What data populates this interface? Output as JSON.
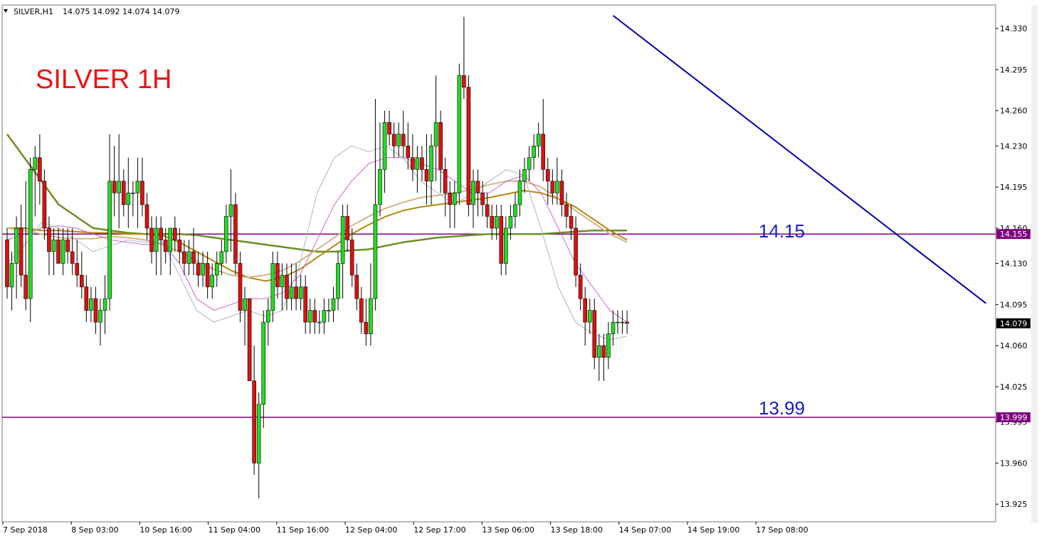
{
  "header": {
    "symbol": "SILVER,H1",
    "ohlc": "14.075 14.092 14.074 14.079"
  },
  "chart_data": {
    "type": "candlestick",
    "title": "SILVER 1H",
    "ylim": [
      13.91,
      14.35
    ],
    "x_ticks": [
      "7 Sep 2018",
      "8 Sep 03:00",
      "10 Sep 16:00",
      "11 Sep 04:00",
      "11 Sep 16:00",
      "12 Sep 04:00",
      "12 Sep 17:00",
      "13 Sep 06:00",
      "13 Sep 18:00",
      "14 Sep 07:00",
      "14 Sep 19:00",
      "17 Sep 08:00"
    ],
    "y_ticks": [
      "14.330",
      "14.295",
      "14.260",
      "14.230",
      "14.195",
      "14.160",
      "14.130",
      "14.095",
      "14.060",
      "14.025",
      "13.995",
      "13.960",
      "13.925"
    ],
    "y_tick_values": [
      14.33,
      14.295,
      14.26,
      14.23,
      14.195,
      14.16,
      14.13,
      14.095,
      14.06,
      14.025,
      13.995,
      13.96,
      13.925
    ],
    "levels": [
      {
        "label": "14.15",
        "badge": "14.155",
        "value": 14.155,
        "color": "#800080"
      },
      {
        "label": "13.99",
        "badge": "13.999",
        "value": 13.999,
        "color": "#800080"
      }
    ],
    "current_price": {
      "label": "14.079",
      "value": 14.079
    },
    "trendline": {
      "color": "#0000aa",
      "start": {
        "bar": 130,
        "price": 14.341
      },
      "end": {
        "bar": 210,
        "price": 14.096
      }
    },
    "candles": [
      [
        14.15,
        14.16,
        14.1,
        14.11
      ],
      [
        14.11,
        14.14,
        14.09,
        14.13
      ],
      [
        14.13,
        14.17,
        14.1,
        14.16
      ],
      [
        14.16,
        14.18,
        14.11,
        14.12
      ],
      [
        14.12,
        14.2,
        14.09,
        14.1
      ],
      [
        14.1,
        14.22,
        14.08,
        14.21
      ],
      [
        14.21,
        14.23,
        14.17,
        14.22
      ],
      [
        14.22,
        14.24,
        14.18,
        14.2
      ],
      [
        14.2,
        14.21,
        14.15,
        14.16
      ],
      [
        14.16,
        14.17,
        14.12,
        14.14
      ],
      [
        14.14,
        14.16,
        14.12,
        14.15
      ],
      [
        14.15,
        14.16,
        14.13,
        14.13
      ],
      [
        14.13,
        14.16,
        14.12,
        14.15
      ],
      [
        14.15,
        14.16,
        14.13,
        14.14
      ],
      [
        14.14,
        14.16,
        14.12,
        14.13
      ],
      [
        14.13,
        14.15,
        14.11,
        14.12
      ],
      [
        14.12,
        14.14,
        14.1,
        14.11
      ],
      [
        14.11,
        14.12,
        14.08,
        14.09
      ],
      [
        14.09,
        14.11,
        14.08,
        14.1
      ],
      [
        14.1,
        14.11,
        14.07,
        14.08
      ],
      [
        14.08,
        14.1,
        14.06,
        14.09
      ],
      [
        14.09,
        14.12,
        14.07,
        14.1
      ],
      [
        14.1,
        14.24,
        14.09,
        14.2
      ],
      [
        14.2,
        14.23,
        14.17,
        14.19
      ],
      [
        14.19,
        14.24,
        14.16,
        14.2
      ],
      [
        14.2,
        14.21,
        14.17,
        14.18
      ],
      [
        14.18,
        14.22,
        14.16,
        14.19
      ],
      [
        14.19,
        14.2,
        14.17,
        14.19
      ],
      [
        14.19,
        14.22,
        14.16,
        14.2
      ],
      [
        14.2,
        14.22,
        14.17,
        14.18
      ],
      [
        14.18,
        14.19,
        14.15,
        14.16
      ],
      [
        14.16,
        14.17,
        14.13,
        14.14
      ],
      [
        14.14,
        14.17,
        14.12,
        14.16
      ],
      [
        14.16,
        14.17,
        14.12,
        14.15
      ],
      [
        14.15,
        14.16,
        14.13,
        14.14
      ],
      [
        14.14,
        14.16,
        14.12,
        14.16
      ],
      [
        14.16,
        14.17,
        14.14,
        14.15
      ],
      [
        14.15,
        14.16,
        14.13,
        14.14
      ],
      [
        14.14,
        14.15,
        14.12,
        14.13
      ],
      [
        14.13,
        14.15,
        14.12,
        14.14
      ],
      [
        14.14,
        14.16,
        14.12,
        14.13
      ],
      [
        14.13,
        14.14,
        14.11,
        14.12
      ],
      [
        14.12,
        14.14,
        14.11,
        14.13
      ],
      [
        14.13,
        14.14,
        14.1,
        14.11
      ],
      [
        14.11,
        14.13,
        14.1,
        14.12
      ],
      [
        14.12,
        14.14,
        14.11,
        14.13
      ],
      [
        14.13,
        14.15,
        14.12,
        14.14
      ],
      [
        14.14,
        14.18,
        14.13,
        14.17
      ],
      [
        14.17,
        14.21,
        14.14,
        14.18
      ],
      [
        14.18,
        14.19,
        14.12,
        14.13
      ],
      [
        14.13,
        14.14,
        14.08,
        14.09
      ],
      [
        14.09,
        14.11,
        14.06,
        14.1
      ],
      [
        14.1,
        14.1,
        14.03,
        14.03
      ],
      [
        14.03,
        14.06,
        13.95,
        13.96
      ],
      [
        13.96,
        14.02,
        13.93,
        14.01
      ],
      [
        14.01,
        14.09,
        13.99,
        14.08
      ],
      [
        14.08,
        14.1,
        14.06,
        14.09
      ],
      [
        14.09,
        14.14,
        14.08,
        14.13
      ],
      [
        14.13,
        14.14,
        14.1,
        14.11
      ],
      [
        14.11,
        14.13,
        14.09,
        14.12
      ],
      [
        14.12,
        14.13,
        14.09,
        14.1
      ],
      [
        14.1,
        14.13,
        14.09,
        14.11
      ],
      [
        14.11,
        14.13,
        14.09,
        14.1
      ],
      [
        14.1,
        14.12,
        14.09,
        14.11
      ],
      [
        14.11,
        14.12,
        14.07,
        14.08
      ],
      [
        14.08,
        14.1,
        14.07,
        14.09
      ],
      [
        14.09,
        14.1,
        14.07,
        14.08
      ],
      [
        14.08,
        14.09,
        14.07,
        14.08
      ],
      [
        14.08,
        14.1,
        14.07,
        14.09
      ],
      [
        14.09,
        14.1,
        14.08,
        14.09
      ],
      [
        14.09,
        14.11,
        14.08,
        14.1
      ],
      [
        14.1,
        14.14,
        14.09,
        14.13
      ],
      [
        14.13,
        14.18,
        14.1,
        14.17
      ],
      [
        14.17,
        14.18,
        14.14,
        14.15
      ],
      [
        14.15,
        14.16,
        14.11,
        14.12
      ],
      [
        14.12,
        14.13,
        14.09,
        14.1
      ],
      [
        14.1,
        14.11,
        14.07,
        14.08
      ],
      [
        14.08,
        14.1,
        14.06,
        14.07
      ],
      [
        14.07,
        14.13,
        14.06,
        14.1
      ],
      [
        14.1,
        14.27,
        14.09,
        14.18
      ],
      [
        14.18,
        14.25,
        14.17,
        14.21
      ],
      [
        14.21,
        14.26,
        14.19,
        14.25
      ],
      [
        14.25,
        14.26,
        14.23,
        14.24
      ],
      [
        14.24,
        14.25,
        14.22,
        14.23
      ],
      [
        14.23,
        14.25,
        14.22,
        14.24
      ],
      [
        14.24,
        14.26,
        14.22,
        14.23
      ],
      [
        14.23,
        14.25,
        14.21,
        14.22
      ],
      [
        14.22,
        14.24,
        14.2,
        14.21
      ],
      [
        14.21,
        14.23,
        14.19,
        14.22
      ],
      [
        14.22,
        14.23,
        14.2,
        14.21
      ],
      [
        14.21,
        14.24,
        14.18,
        14.2
      ],
      [
        14.2,
        14.24,
        14.18,
        14.23
      ],
      [
        14.23,
        14.29,
        14.2,
        14.25
      ],
      [
        14.25,
        14.26,
        14.19,
        14.21
      ],
      [
        14.21,
        14.22,
        14.17,
        14.19
      ],
      [
        14.19,
        14.2,
        14.16,
        14.18
      ],
      [
        14.18,
        14.2,
        14.16,
        14.19
      ],
      [
        14.19,
        14.3,
        14.18,
        14.29
      ],
      [
        14.29,
        14.34,
        14.27,
        14.28
      ],
      [
        14.28,
        14.29,
        14.17,
        14.18
      ],
      [
        14.18,
        14.21,
        14.16,
        14.2
      ],
      [
        14.2,
        14.21,
        14.17,
        14.19
      ],
      [
        14.19,
        14.2,
        14.17,
        14.18
      ],
      [
        14.18,
        14.19,
        14.16,
        14.17
      ],
      [
        14.17,
        14.18,
        14.15,
        14.16
      ],
      [
        14.16,
        14.18,
        14.15,
        14.17
      ],
      [
        14.17,
        14.18,
        14.12,
        14.13
      ],
      [
        14.13,
        14.17,
        14.12,
        14.16
      ],
      [
        14.16,
        14.18,
        14.15,
        14.17
      ],
      [
        14.17,
        14.19,
        14.16,
        14.18
      ],
      [
        14.18,
        14.21,
        14.17,
        14.2
      ],
      [
        14.2,
        14.22,
        14.19,
        14.21
      ],
      [
        14.21,
        14.23,
        14.2,
        14.22
      ],
      [
        14.22,
        14.24,
        14.21,
        14.23
      ],
      [
        14.23,
        14.25,
        14.22,
        14.24
      ],
      [
        14.24,
        14.27,
        14.2,
        14.21
      ],
      [
        14.21,
        14.22,
        14.18,
        14.2
      ],
      [
        14.2,
        14.21,
        14.18,
        14.19
      ],
      [
        14.19,
        14.22,
        14.18,
        14.2
      ],
      [
        14.2,
        14.21,
        14.17,
        14.18
      ],
      [
        14.18,
        14.19,
        14.16,
        14.17
      ],
      [
        14.17,
        14.18,
        14.15,
        14.16
      ],
      [
        14.16,
        14.17,
        14.11,
        14.12
      ],
      [
        14.12,
        14.13,
        14.09,
        14.1
      ],
      [
        14.1,
        14.11,
        14.06,
        14.08
      ],
      [
        14.08,
        14.1,
        14.07,
        14.09
      ],
      [
        14.09,
        14.1,
        14.04,
        14.05
      ],
      [
        14.05,
        14.07,
        14.03,
        14.06
      ],
      [
        14.06,
        14.07,
        14.03,
        14.05
      ],
      [
        14.05,
        14.08,
        14.04,
        14.07
      ],
      [
        14.07,
        14.09,
        14.06,
        14.08
      ],
      [
        14.08,
        14.09,
        14.07,
        14.08
      ],
      [
        14.08,
        14.09,
        14.07,
        14.08
      ],
      [
        14.08,
        14.09,
        14.07,
        14.079
      ]
    ],
    "moving_averages": [
      {
        "color": "#6b8e23",
        "width": 2.5,
        "values": [
          14.24,
          14.22,
          14.2,
          14.18,
          14.17,
          14.16,
          14.158,
          14.156,
          14.155,
          14.155,
          14.155,
          14.154,
          14.152,
          14.15,
          14.148,
          14.146,
          14.144,
          14.142,
          14.14,
          14.14,
          14.141,
          14.142,
          14.145,
          14.148,
          14.15,
          14.152,
          14.153,
          14.154,
          14.155,
          14.155,
          14.155,
          14.155,
          14.156,
          14.157,
          14.158,
          14.158,
          14.158
        ]
      },
      {
        "color": "#b8860b",
        "width": 2,
        "values": [
          14.16,
          14.16,
          14.158,
          14.158,
          14.157,
          14.156,
          14.156,
          14.155,
          14.155,
          14.154,
          14.148,
          14.14,
          14.132,
          14.124,
          14.118,
          14.115,
          14.118,
          14.125,
          14.135,
          14.145,
          14.155,
          14.163,
          14.17,
          14.175,
          14.178,
          14.18,
          14.182,
          14.184,
          14.186,
          14.189,
          14.192,
          14.19,
          14.185,
          14.178,
          14.168,
          14.158,
          14.15
        ]
      },
      {
        "color": "#d2b48c",
        "width": 2,
        "values": [
          14.16,
          14.158,
          14.155,
          14.152,
          14.151,
          14.151,
          14.153,
          14.152,
          14.15,
          14.146,
          14.14,
          14.132,
          14.125,
          14.12,
          14.118,
          14.12,
          14.124,
          14.132,
          14.142,
          14.152,
          14.162,
          14.17,
          14.177,
          14.182,
          14.186,
          14.188,
          14.19,
          14.193,
          14.197,
          14.2,
          14.2,
          14.195,
          14.185,
          14.175,
          14.165,
          14.155,
          14.148
        ]
      },
      {
        "color": "#cc66cc",
        "width": 1,
        "values": [
          14.15,
          14.155,
          14.16,
          14.162,
          14.16,
          14.155,
          14.15,
          14.148,
          14.146,
          14.148,
          14.13,
          14.1,
          14.09,
          14.095,
          14.1,
          14.1,
          14.105,
          14.12,
          14.15,
          14.18,
          14.2,
          14.215,
          14.22,
          14.22,
          14.215,
          14.21,
          14.2,
          14.19,
          14.19,
          14.2,
          14.205,
          14.19,
          14.16,
          14.13,
          14.11,
          14.09,
          14.08
        ]
      },
      {
        "color": "#aab6c8",
        "width": 1,
        "values": [
          14.13,
          14.145,
          14.165,
          14.16,
          14.15,
          14.14,
          14.145,
          14.15,
          14.148,
          14.15,
          14.12,
          14.09,
          14.08,
          14.085,
          14.09,
          14.085,
          14.09,
          14.13,
          14.19,
          14.22,
          14.23,
          14.225,
          14.23,
          14.22,
          14.2,
          14.19,
          14.18,
          14.19,
          14.2,
          14.21,
          14.205,
          14.16,
          14.11,
          14.08,
          14.07,
          14.065,
          14.068
        ]
      }
    ]
  }
}
